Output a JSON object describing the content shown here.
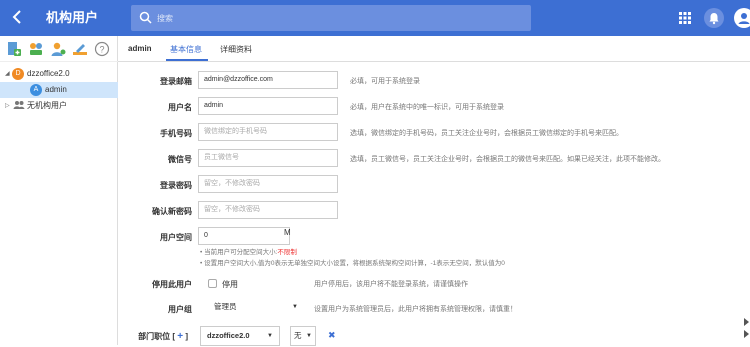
{
  "header": {
    "title": "机构用户",
    "search_placeholder": "搜索"
  },
  "sidebar": {
    "tree": [
      {
        "avatar": "D",
        "label": "dzzoffice2.0",
        "avatar_color": "#f08a24"
      },
      {
        "avatar": "A",
        "label": "admin",
        "avatar_color": "#3d8fe0"
      },
      {
        "label": "无机构用户"
      }
    ]
  },
  "tabs": {
    "user_name": "admin",
    "items": [
      "基本信息",
      "详细资料"
    ]
  },
  "form": {
    "email": {
      "label": "登录邮箱",
      "value": "admin@dzzoffice.com",
      "hint": "必填，可用于系统登录"
    },
    "username": {
      "label": "用户名",
      "value": "admin",
      "hint": "必填，用户在系统中的唯一标识，可用于系统登录"
    },
    "phone": {
      "label": "手机号码",
      "placeholder": "微信绑定的手机号码",
      "hint": "选填，微信绑定的手机号码，员工关注企业号时，会根据员工微信绑定的手机号来匹配。"
    },
    "wechat": {
      "label": "微信号",
      "placeholder": "员工微信号",
      "hint": "选填，员工微信号，员工关注企业号时，会根据员工的微信号来匹配。如果已经关注，此项不能修改。"
    },
    "password": {
      "label": "登录密码",
      "placeholder": "留空，不修改密码"
    },
    "confirm_password": {
      "label": "确认新密码",
      "placeholder": "留空，不修改密码"
    },
    "space": {
      "label": "用户空间",
      "value": "0",
      "unit": "M",
      "note1_prefix": "当前用户可分配空间大小:",
      "note1_value": "不限制",
      "note2": "设置用户空间大小,值为0表示无单独空间大小设置，将根据系统架构空间计算，-1表示无空间，默认值为0"
    },
    "disable": {
      "label": "停用此用户",
      "option": "停用",
      "hint": "用户停用后，该用户将不能登录系统，请谨慎操作"
    },
    "group": {
      "label": "用户组",
      "selected": "管理员",
      "hint": "设置用户为系统管理员后，此用户将拥有系统管理权限，请慎重！"
    },
    "dept": {
      "label": "部门职位",
      "add_symbol": "+",
      "org_selected": "dzzoffice2.0",
      "position_selected": "无",
      "remove_symbol": "✖"
    }
  },
  "colors": {
    "brand": "#3d6fd3",
    "warning": "#e33333"
  }
}
